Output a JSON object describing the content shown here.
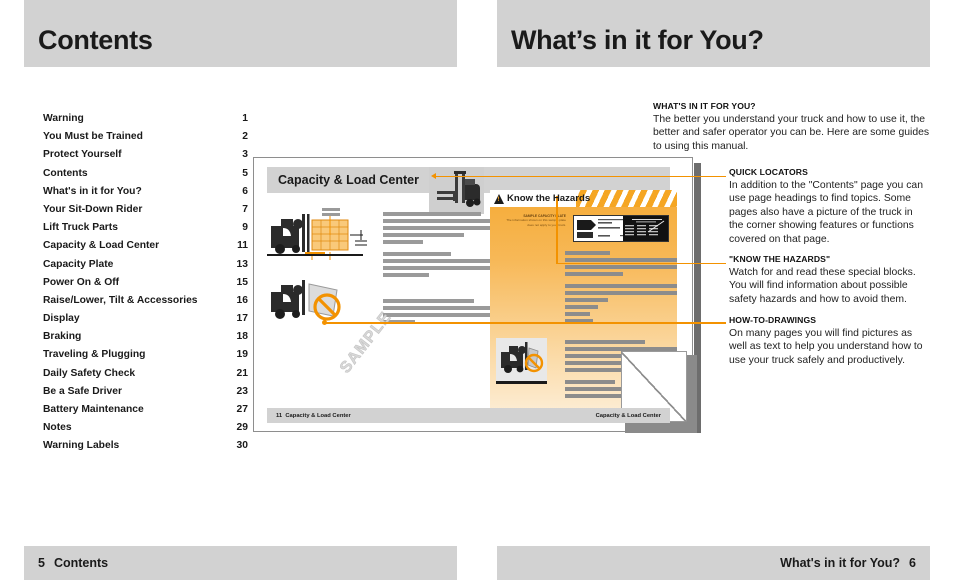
{
  "colors": {
    "band": "#d2d2d2",
    "accent_orange": "#f39200",
    "hazard_yellow": "#f5a623",
    "text": "#1a1a1a",
    "placeholder_bar": "#9a9a9a"
  },
  "left_page": {
    "header_title": "Contents",
    "footer_page": "5",
    "footer_label": "Contents",
    "toc": [
      {
        "label": "Warning",
        "page": "1"
      },
      {
        "label": "You Must be Trained",
        "page": "2"
      },
      {
        "label": "Protect Yourself",
        "page": "3"
      },
      {
        "label": "Contents",
        "page": "5"
      },
      {
        "label": "What's in it for You?",
        "page": "6"
      },
      {
        "label": "Your Sit-Down Rider",
        "page": "7"
      },
      {
        "label": "Lift Truck Parts",
        "page": "9"
      },
      {
        "label": "Capacity & Load Center",
        "page": "11"
      },
      {
        "label": "Capacity Plate",
        "page": "13"
      },
      {
        "label": "Power On & Off",
        "page": "15"
      },
      {
        "label": "Raise/Lower, Tilt & Accessories",
        "page": "16"
      },
      {
        "label": "Display",
        "page": "17"
      },
      {
        "label": "Braking",
        "page": "18"
      },
      {
        "label": "Traveling & Plugging",
        "page": "19"
      },
      {
        "label": "Daily Safety Check",
        "page": "21"
      },
      {
        "label": "Be a Safe Driver",
        "page": "23"
      },
      {
        "label": "Battery Maintenance",
        "page": "27"
      },
      {
        "label": "Notes",
        "page": "29"
      },
      {
        "label": "Warning Labels",
        "page": "30"
      }
    ]
  },
  "right_page": {
    "header_title": "What’s in it for You?",
    "footer_label": "What's in it for You?",
    "footer_page": "6",
    "intro": {
      "heading": "WHAT'S IN IT FOR YOU?",
      "body": "The better you understand your truck and how to use it, the better and safer operator you can be. Here are some guides to using this manual."
    },
    "callouts": [
      {
        "heading": "QUICK LOCATORS",
        "body": "In addition to the \"Contents\" page you can use page headings to find topics. Some pages also have a picture of the truck in the corner showing features or functions covered on that page."
      },
      {
        "heading": "\"KNOW THE HAZARDS\"",
        "body": "Watch for and read these special blocks. You will find information about possible safety hazards and how to avoid them."
      },
      {
        "heading": "HOW-TO-DRAWINGS",
        "body": "On many pages you will find pictures as well as text to help you understand how to use your truck safely and productively."
      }
    ]
  },
  "mockup_page": {
    "header_title": "Capacity & Load Center",
    "hazard_box_label": "Know the Hazards",
    "plate_caption_heading": "SAMPLE CAPACITY PLATE",
    "plate_caption_body": "The information shown on this sample plate does not apply to your truck.",
    "watermark": "SAMPLE",
    "footer_page": "11",
    "footer_left_label": "Capacity & Load Center",
    "footer_right_label": "Capacity & Load Center"
  }
}
